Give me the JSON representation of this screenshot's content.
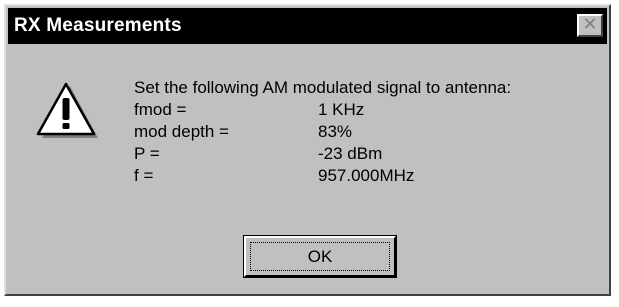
{
  "window": {
    "title": "RX Measurements",
    "close_symbol": "✕"
  },
  "icon": "warning-exclamation-icon",
  "message": {
    "intro": "Set the following AM modulated signal to antenna:",
    "rows": [
      {
        "label": "fmod =",
        "value": "1 KHz"
      },
      {
        "label": "mod depth =",
        "value": "83%"
      },
      {
        "label": "P =",
        "value": "-23 dBm"
      },
      {
        "label": "f =",
        "value": "957.000MHz"
      }
    ]
  },
  "buttons": {
    "ok_label": "OK"
  },
  "colors": {
    "title_bar": "#000000",
    "dialog_face": "#c0c0c0",
    "warning_fill": "#ffffff"
  }
}
